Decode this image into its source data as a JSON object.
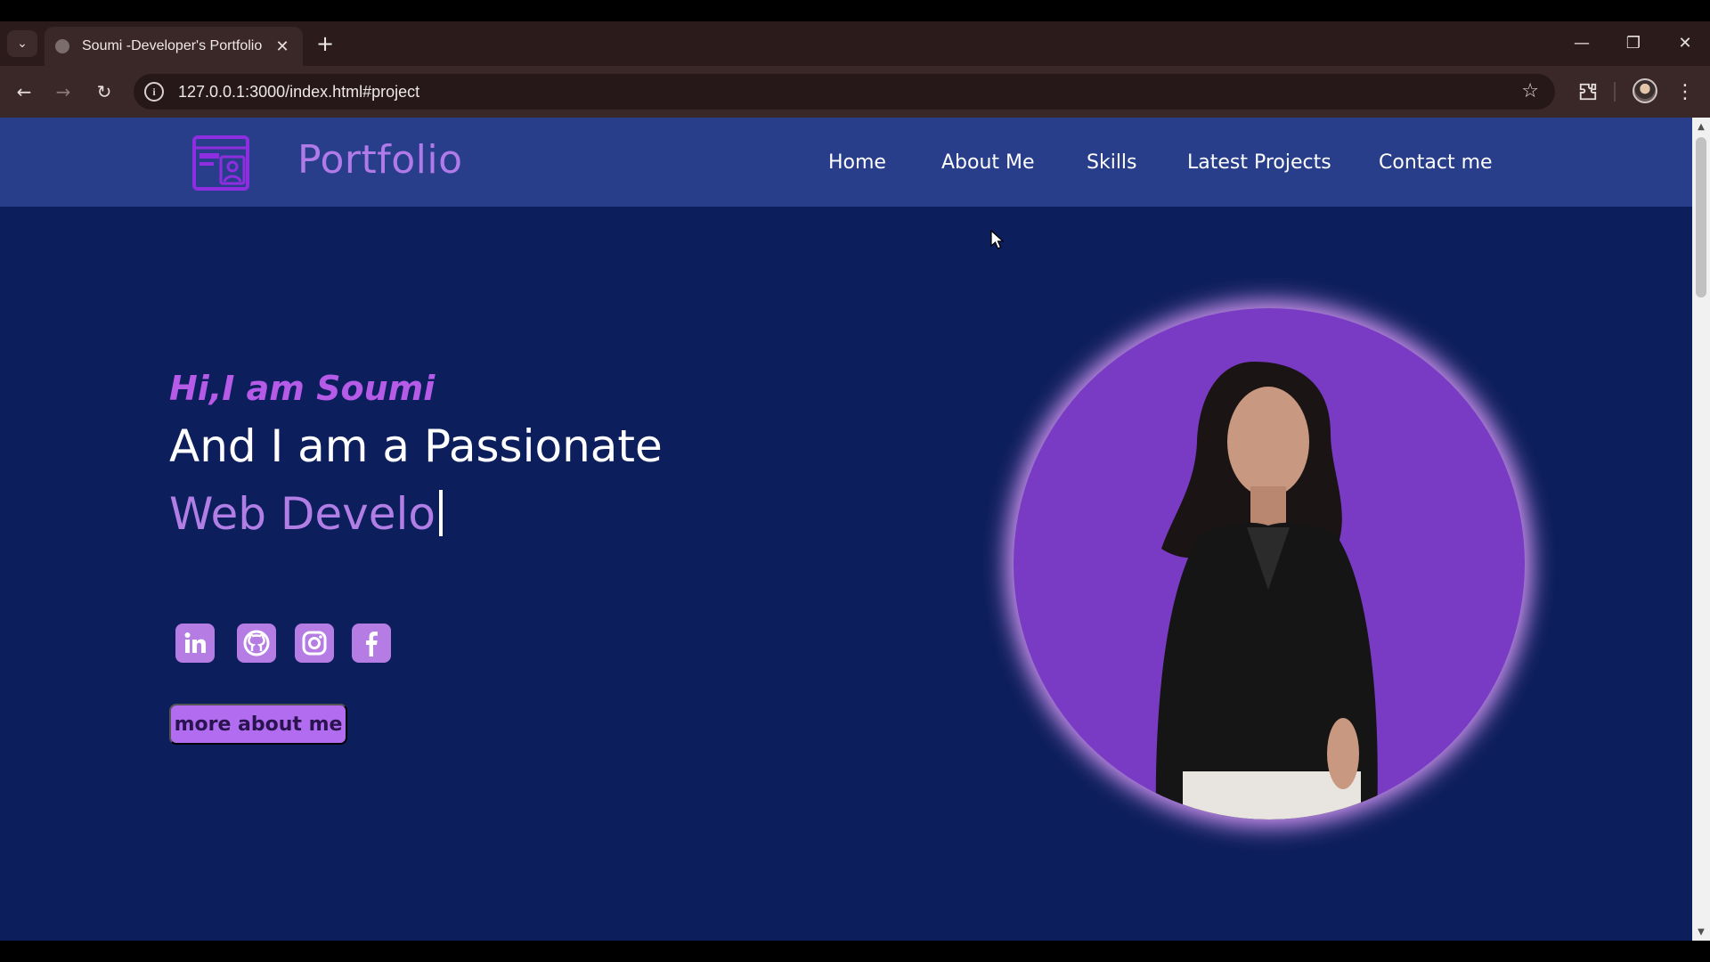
{
  "browser": {
    "tab_title": "Soumi -Developer's Portfolio",
    "tab_close": "✕",
    "new_tab": "+",
    "url": "127.0.0.1:3000/index.html#project",
    "window_controls": {
      "minimize": "—",
      "restore": "❐",
      "close": "✕"
    }
  },
  "site": {
    "brand": "Portfolio",
    "nav": [
      "Home",
      "About Me",
      "Skills",
      "Latest Projects",
      "Contact me"
    ]
  },
  "hero": {
    "greeting": "Hi,I am Soumi",
    "line1": "And I am a Passionate",
    "line2": "Web Develo",
    "cta": "more about me"
  },
  "social": [
    "linkedin-icon",
    "github-icon",
    "instagram-icon",
    "facebook-icon"
  ],
  "colors": {
    "header_bg": "#283e8a",
    "page_bg": "#0d1e5c",
    "accent_purple": "#b07ae8",
    "greeting_purple": "#b65ae8",
    "photo_bg": "#7a3bc4"
  }
}
